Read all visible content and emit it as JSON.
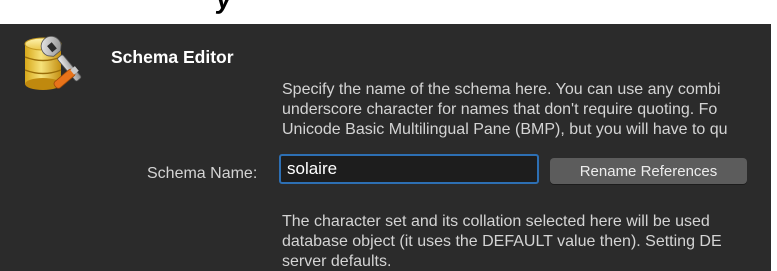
{
  "top_partial_title": "y",
  "panel": {
    "title": "Schema Editor",
    "logo_icon": "database-wrench-icon"
  },
  "description_top": {
    "line1": "Specify the name of the schema here. You can use any combi",
    "line2": "underscore character for names that don't require quoting. Fo",
    "line3": "Unicode Basic Multilingual Pane (BMP), but you will have to qu"
  },
  "schema_name": {
    "label": "Schema Name:",
    "value": "solaire"
  },
  "rename_button": {
    "label": "Rename References"
  },
  "description_bottom": {
    "line1": "The character set and its collation selected here will be used",
    "line2": "database object (it uses the DEFAULT value then). Setting DE",
    "line3": "server defaults."
  },
  "colors": {
    "background": "#2b2b2b",
    "focus_ring": "#2d6fb3",
    "button_bg": "#5c5c5c",
    "text": "#d4d4d4",
    "title_text": "#ffffff"
  }
}
